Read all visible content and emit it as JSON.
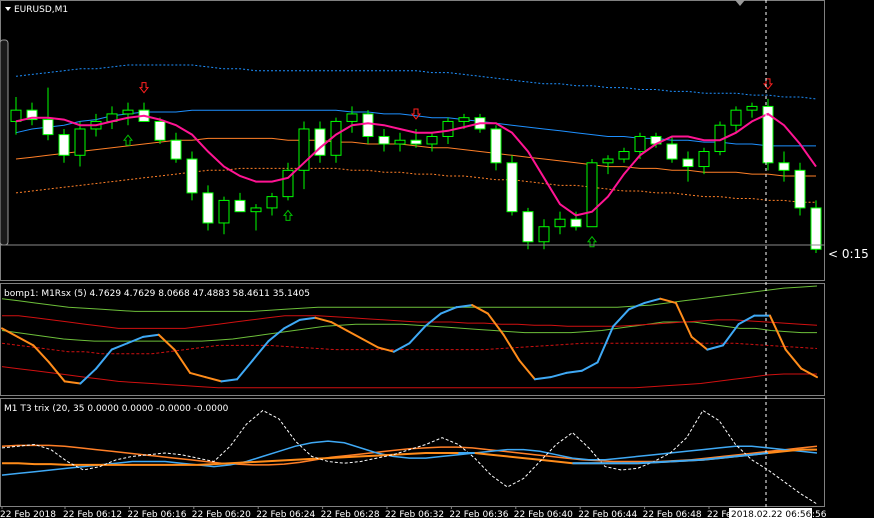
{
  "symbol_label": "EURUSD,M1",
  "countdown": "< 0:15",
  "panel2_label": "bomp1: M1Rsx (5) 4.7629 4.7629 8.0668 47.4883 58.4611 35.1405",
  "panel3_label": "M1 T3 trix (20, 35 0.0000 0.0000 -0.0000 -0.0000",
  "time_axis": {
    "ticks": [
      "22 Feb 2018",
      "22 Feb 06:12",
      "22 Feb 06:16",
      "22 Feb 06:20",
      "22 Feb 06:24",
      "22 Feb 06:28",
      "22 Feb 06:32",
      "22 Feb 06:36",
      "22 Feb 06:40",
      "22 Feb 06:44",
      "22 Feb 06:48",
      "22 Feb 06:52"
    ],
    "cursor_label": "2018.02.22 06:56",
    "cursor_suffix": ":56"
  },
  "colors": {
    "background": "#000000",
    "bull_candle": "#000000",
    "bear_candle": "#ffffff",
    "wick": "#00ff00",
    "magenta_ma": "#ff1493",
    "blue_band": "#1e90ff",
    "orange_band": "#ff7f27",
    "up_arrow": "#00c000",
    "down_arrow": "#ff2020",
    "rsx_rising": "#3fa9f5",
    "rsx_falling": "#ff8c1a",
    "band_green": "#6dbf3a",
    "band_red": "#d01010"
  },
  "chart_data": [
    {
      "type": "candlestick",
      "title": "EURUSD,M1",
      "ylim": [
        0,
        100
      ],
      "candles": [
        {
          "o": 62,
          "h": 75,
          "l": 55,
          "c": 68
        },
        {
          "o": 68,
          "h": 72,
          "l": 60,
          "c": 63
        },
        {
          "o": 63,
          "h": 80,
          "l": 52,
          "c": 55
        },
        {
          "o": 55,
          "h": 58,
          "l": 40,
          "c": 44
        },
        {
          "o": 44,
          "h": 62,
          "l": 38,
          "c": 58
        },
        {
          "o": 58,
          "h": 66,
          "l": 54,
          "c": 62
        },
        {
          "o": 62,
          "h": 70,
          "l": 58,
          "c": 66
        },
        {
          "o": 66,
          "h": 72,
          "l": 60,
          "c": 68
        },
        {
          "o": 68,
          "h": 72,
          "l": 62,
          "c": 62
        },
        {
          "o": 62,
          "h": 64,
          "l": 50,
          "c": 52
        },
        {
          "o": 52,
          "h": 56,
          "l": 40,
          "c": 42
        },
        {
          "o": 42,
          "h": 46,
          "l": 20,
          "c": 24
        },
        {
          "o": 24,
          "h": 28,
          "l": 4,
          "c": 8
        },
        {
          "o": 8,
          "h": 22,
          "l": 2,
          "c": 20
        },
        {
          "o": 20,
          "h": 24,
          "l": 14,
          "c": 14
        },
        {
          "o": 14,
          "h": 18,
          "l": 4,
          "c": 16
        },
        {
          "o": 16,
          "h": 24,
          "l": 12,
          "c": 22
        },
        {
          "o": 22,
          "h": 40,
          "l": 20,
          "c": 36
        },
        {
          "o": 36,
          "h": 62,
          "l": 26,
          "c": 58
        },
        {
          "o": 58,
          "h": 62,
          "l": 40,
          "c": 44
        },
        {
          "o": 44,
          "h": 64,
          "l": 40,
          "c": 62
        },
        {
          "o": 62,
          "h": 70,
          "l": 56,
          "c": 66
        },
        {
          "o": 66,
          "h": 68,
          "l": 50,
          "c": 54
        },
        {
          "o": 54,
          "h": 58,
          "l": 46,
          "c": 50
        },
        {
          "o": 50,
          "h": 56,
          "l": 46,
          "c": 52
        },
        {
          "o": 52,
          "h": 58,
          "l": 48,
          "c": 50
        },
        {
          "o": 50,
          "h": 56,
          "l": 46,
          "c": 54
        },
        {
          "o": 54,
          "h": 64,
          "l": 50,
          "c": 62
        },
        {
          "o": 62,
          "h": 66,
          "l": 58,
          "c": 64
        },
        {
          "o": 64,
          "h": 66,
          "l": 56,
          "c": 58
        },
        {
          "o": 58,
          "h": 60,
          "l": 36,
          "c": 40
        },
        {
          "o": 40,
          "h": 44,
          "l": 12,
          "c": 14
        },
        {
          "o": 14,
          "h": 16,
          "l": -6,
          "c": -2
        },
        {
          "o": -2,
          "h": 10,
          "l": -6,
          "c": 6
        },
        {
          "o": 6,
          "h": 14,
          "l": 2,
          "c": 10
        },
        {
          "o": 10,
          "h": 14,
          "l": 4,
          "c": 6
        },
        {
          "o": 6,
          "h": 42,
          "l": 6,
          "c": 40
        },
        {
          "o": 40,
          "h": 44,
          "l": 34,
          "c": 42
        },
        {
          "o": 42,
          "h": 48,
          "l": 40,
          "c": 46
        },
        {
          "o": 46,
          "h": 56,
          "l": 42,
          "c": 54
        },
        {
          "o": 54,
          "h": 56,
          "l": 48,
          "c": 50
        },
        {
          "o": 50,
          "h": 54,
          "l": 40,
          "c": 42
        },
        {
          "o": 42,
          "h": 46,
          "l": 30,
          "c": 38
        },
        {
          "o": 38,
          "h": 48,
          "l": 34,
          "c": 46
        },
        {
          "o": 46,
          "h": 62,
          "l": 44,
          "c": 60
        },
        {
          "o": 60,
          "h": 70,
          "l": 56,
          "c": 68
        },
        {
          "o": 68,
          "h": 72,
          "l": 64,
          "c": 70
        },
        {
          "o": 70,
          "h": 74,
          "l": 36,
          "c": 40
        },
        {
          "o": 40,
          "h": 46,
          "l": 30,
          "c": 36
        },
        {
          "o": 36,
          "h": 40,
          "l": 12,
          "c": 16
        },
        {
          "o": 16,
          "h": 20,
          "l": -8,
          "c": -6
        }
      ],
      "ma": [
        62,
        64,
        64,
        63,
        60,
        60,
        62,
        64,
        65,
        63,
        60,
        55,
        46,
        38,
        33,
        30,
        30,
        32,
        40,
        48,
        55,
        60,
        61,
        60,
        58,
        56,
        56,
        57,
        59,
        61,
        61,
        56,
        46,
        32,
        18,
        12,
        14,
        22,
        34,
        44,
        50,
        54,
        54,
        52,
        52,
        56,
        62,
        66,
        60,
        50,
        38
      ],
      "upper_band": [
        86,
        87,
        88,
        89,
        90,
        90,
        91,
        92,
        92,
        92,
        92,
        92,
        91,
        90,
        90,
        89,
        89,
        89,
        89,
        89,
        89,
        89,
        89,
        89,
        89,
        89,
        88,
        88,
        87,
        86,
        85,
        84,
        83,
        82,
        82,
        81,
        81,
        80,
        80,
        79,
        79,
        78,
        78,
        77,
        77,
        77,
        76,
        76,
        75,
        75,
        74
      ],
      "blue_band": [
        56,
        58,
        59,
        60,
        62,
        63,
        65,
        66,
        67,
        67,
        67,
        68,
        68,
        68,
        68,
        68,
        68,
        68,
        68,
        68,
        68,
        67,
        67,
        66,
        66,
        65,
        64,
        64,
        63,
        62,
        61,
        60,
        59,
        58,
        57,
        56,
        55,
        54,
        54,
        53,
        53,
        52,
        52,
        51,
        51,
        50,
        50,
        49,
        49,
        49,
        49
      ],
      "orange_band": [
        42,
        43,
        44,
        45,
        46,
        47,
        48,
        49,
        50,
        51,
        52,
        52,
        53,
        53,
        53,
        53,
        53,
        52,
        52,
        52,
        51,
        51,
        50,
        50,
        50,
        49,
        48,
        48,
        47,
        46,
        45,
        44,
        43,
        42,
        41,
        40,
        39,
        38,
        38,
        37,
        37,
        36,
        36,
        35,
        35,
        35,
        34,
        34,
        33,
        33,
        33
      ],
      "lower_band": [
        24,
        25,
        26,
        27,
        28,
        29,
        30,
        31,
        32,
        33,
        34,
        35,
        36,
        36,
        37,
        37,
        37,
        37,
        37,
        37,
        37,
        36,
        36,
        35,
        35,
        34,
        34,
        33,
        33,
        32,
        31,
        31,
        30,
        29,
        28,
        28,
        27,
        26,
        25,
        25,
        24,
        24,
        23,
        22,
        22,
        21,
        21,
        20,
        20,
        19,
        19
      ],
      "up_arrows": [
        7,
        17,
        36
      ],
      "down_arrows": [
        8,
        25,
        47
      ]
    },
    {
      "type": "line",
      "title": "bomp1: M1Rsx (5)",
      "ylim": [
        0,
        100
      ],
      "series": [
        {
          "values": [
            60,
            52,
            44,
            28,
            10,
            8,
            22,
            40,
            46,
            52,
            54,
            40,
            18,
            14,
            10,
            12,
            30,
            48,
            60,
            68,
            70,
            66,
            58,
            50,
            42,
            38,
            46,
            62,
            74,
            80,
            82,
            74,
            54,
            30,
            12,
            14,
            18,
            20,
            28,
            62,
            78,
            84,
            88,
            84,
            52,
            40,
            44,
            64,
            72,
            72,
            40,
            22,
            14
          ]
        },
        {
          "values": [
            88,
            86,
            84,
            82,
            80,
            79,
            78,
            77,
            76,
            76,
            76,
            76,
            76,
            76,
            76,
            76,
            77,
            78,
            79,
            80,
            80,
            80,
            80,
            80,
            80,
            80,
            80,
            80,
            80,
            80,
            80,
            80,
            80,
            80,
            80,
            80,
            80,
            80,
            81,
            82,
            84,
            86,
            88,
            90,
            92,
            94,
            96,
            98,
            99,
            100
          ]
        },
        {
          "values": [
            58,
            56,
            54,
            52,
            50,
            49,
            48,
            48,
            48,
            48,
            48,
            48,
            48,
            48,
            49,
            50,
            52,
            54,
            56,
            58,
            60,
            62,
            63,
            64,
            64,
            64,
            64,
            63,
            62,
            61,
            60,
            59,
            58,
            57,
            56,
            56,
            56,
            56,
            57,
            58,
            60,
            62,
            64,
            66,
            66,
            66,
            64,
            62,
            60,
            60,
            58,
            57,
            56,
            56
          ]
        },
        {
          "values": [
            72,
            72,
            70,
            68,
            66,
            64,
            62,
            60,
            60,
            60,
            60,
            60,
            62,
            64,
            66,
            68,
            70,
            72,
            72,
            72,
            71,
            70,
            69,
            68,
            67,
            66,
            66,
            66,
            65,
            65,
            64,
            64,
            63,
            63,
            62,
            62,
            62,
            62,
            63,
            64,
            65,
            66,
            67,
            68,
            68,
            67,
            66,
            65,
            64,
            63
          ]
        },
        {
          "values": [
            46,
            44,
            42,
            40,
            38,
            38,
            36,
            36,
            36,
            36,
            38,
            40,
            42,
            44,
            44,
            44,
            44,
            43,
            42,
            41,
            40,
            40,
            40,
            40,
            40,
            40,
            40,
            40,
            40,
            40,
            41,
            42,
            43,
            44,
            45,
            46,
            46,
            46,
            46,
            46,
            46,
            46,
            46,
            46,
            46,
            45,
            44,
            43,
            42,
            41
          ]
        },
        {
          "values": [
            24,
            22,
            20,
            18,
            16,
            14,
            12,
            10,
            9,
            8,
            7,
            6,
            5,
            4,
            4,
            4,
            4,
            4,
            4,
            4,
            4,
            4,
            4,
            4,
            4,
            4,
            4,
            4,
            4,
            4,
            4,
            4,
            4,
            4,
            4,
            4,
            4,
            4,
            4,
            5,
            6,
            7,
            8,
            10,
            12,
            14,
            16,
            17,
            17,
            17
          ]
        }
      ]
    },
    {
      "type": "line",
      "title": "M1 T3 trix",
      "ylim": [
        -60,
        60
      ],
      "series": [
        {
          "values": [
            8,
            9,
            9,
            9,
            8,
            6,
            4,
            2,
            0,
            -2,
            -4,
            -6,
            -8,
            -10,
            -12,
            -13,
            -14,
            -14,
            -13,
            -11,
            -8,
            -5,
            -3,
            -1,
            1,
            3,
            5,
            6,
            7,
            7,
            6,
            4,
            2,
            0,
            -2,
            -4,
            -6,
            -8,
            -9,
            -10,
            -10,
            -10,
            -10,
            -9,
            -8,
            -6,
            -4,
            -2,
            0,
            2,
            4,
            6,
            8
          ]
        },
        {
          "values": [
            -26,
            -24,
            -22,
            -20,
            -18,
            -16,
            -14,
            -12,
            -10,
            -10,
            -10,
            -12,
            -14,
            -16,
            -14,
            -10,
            -4,
            2,
            8,
            12,
            14,
            12,
            6,
            0,
            -4,
            -6,
            -6,
            -4,
            -2,
            0,
            2,
            4,
            4,
            2,
            -2,
            -6,
            -8,
            -8,
            -6,
            -4,
            -2,
            0,
            2,
            4,
            6,
            8,
            8,
            6,
            4,
            2,
            0
          ]
        },
        {
          "values": [
            -12,
            -12,
            -13,
            -13,
            -14,
            -14,
            -14,
            -14,
            -14,
            -14,
            -14,
            -14,
            -14,
            -13,
            -12,
            -11,
            -10,
            -9,
            -8,
            -7,
            -6,
            -5,
            -4,
            -3,
            -2,
            -1,
            0,
            0,
            0,
            0,
            -2,
            -4,
            -6,
            -8,
            -10,
            -12,
            -12,
            -12,
            -12,
            -12,
            -11,
            -10,
            -9,
            -8,
            -6,
            -4,
            -2,
            0,
            2,
            4,
            4
          ]
        },
        {
          "values": [
            6,
            8,
            10,
            4,
            -10,
            -20,
            -16,
            -8,
            -4,
            -2,
            0,
            -2,
            -6,
            -10,
            8,
            34,
            50,
            40,
            14,
            -4,
            -10,
            -12,
            -10,
            -6,
            -2,
            4,
            10,
            18,
            10,
            -6,
            -26,
            -40,
            -30,
            -10,
            10,
            24,
            6,
            -16,
            -20,
            -18,
            -10,
            0,
            18,
            50,
            38,
            10,
            -8,
            -20,
            -34,
            -48,
            -60
          ]
        }
      ]
    }
  ]
}
